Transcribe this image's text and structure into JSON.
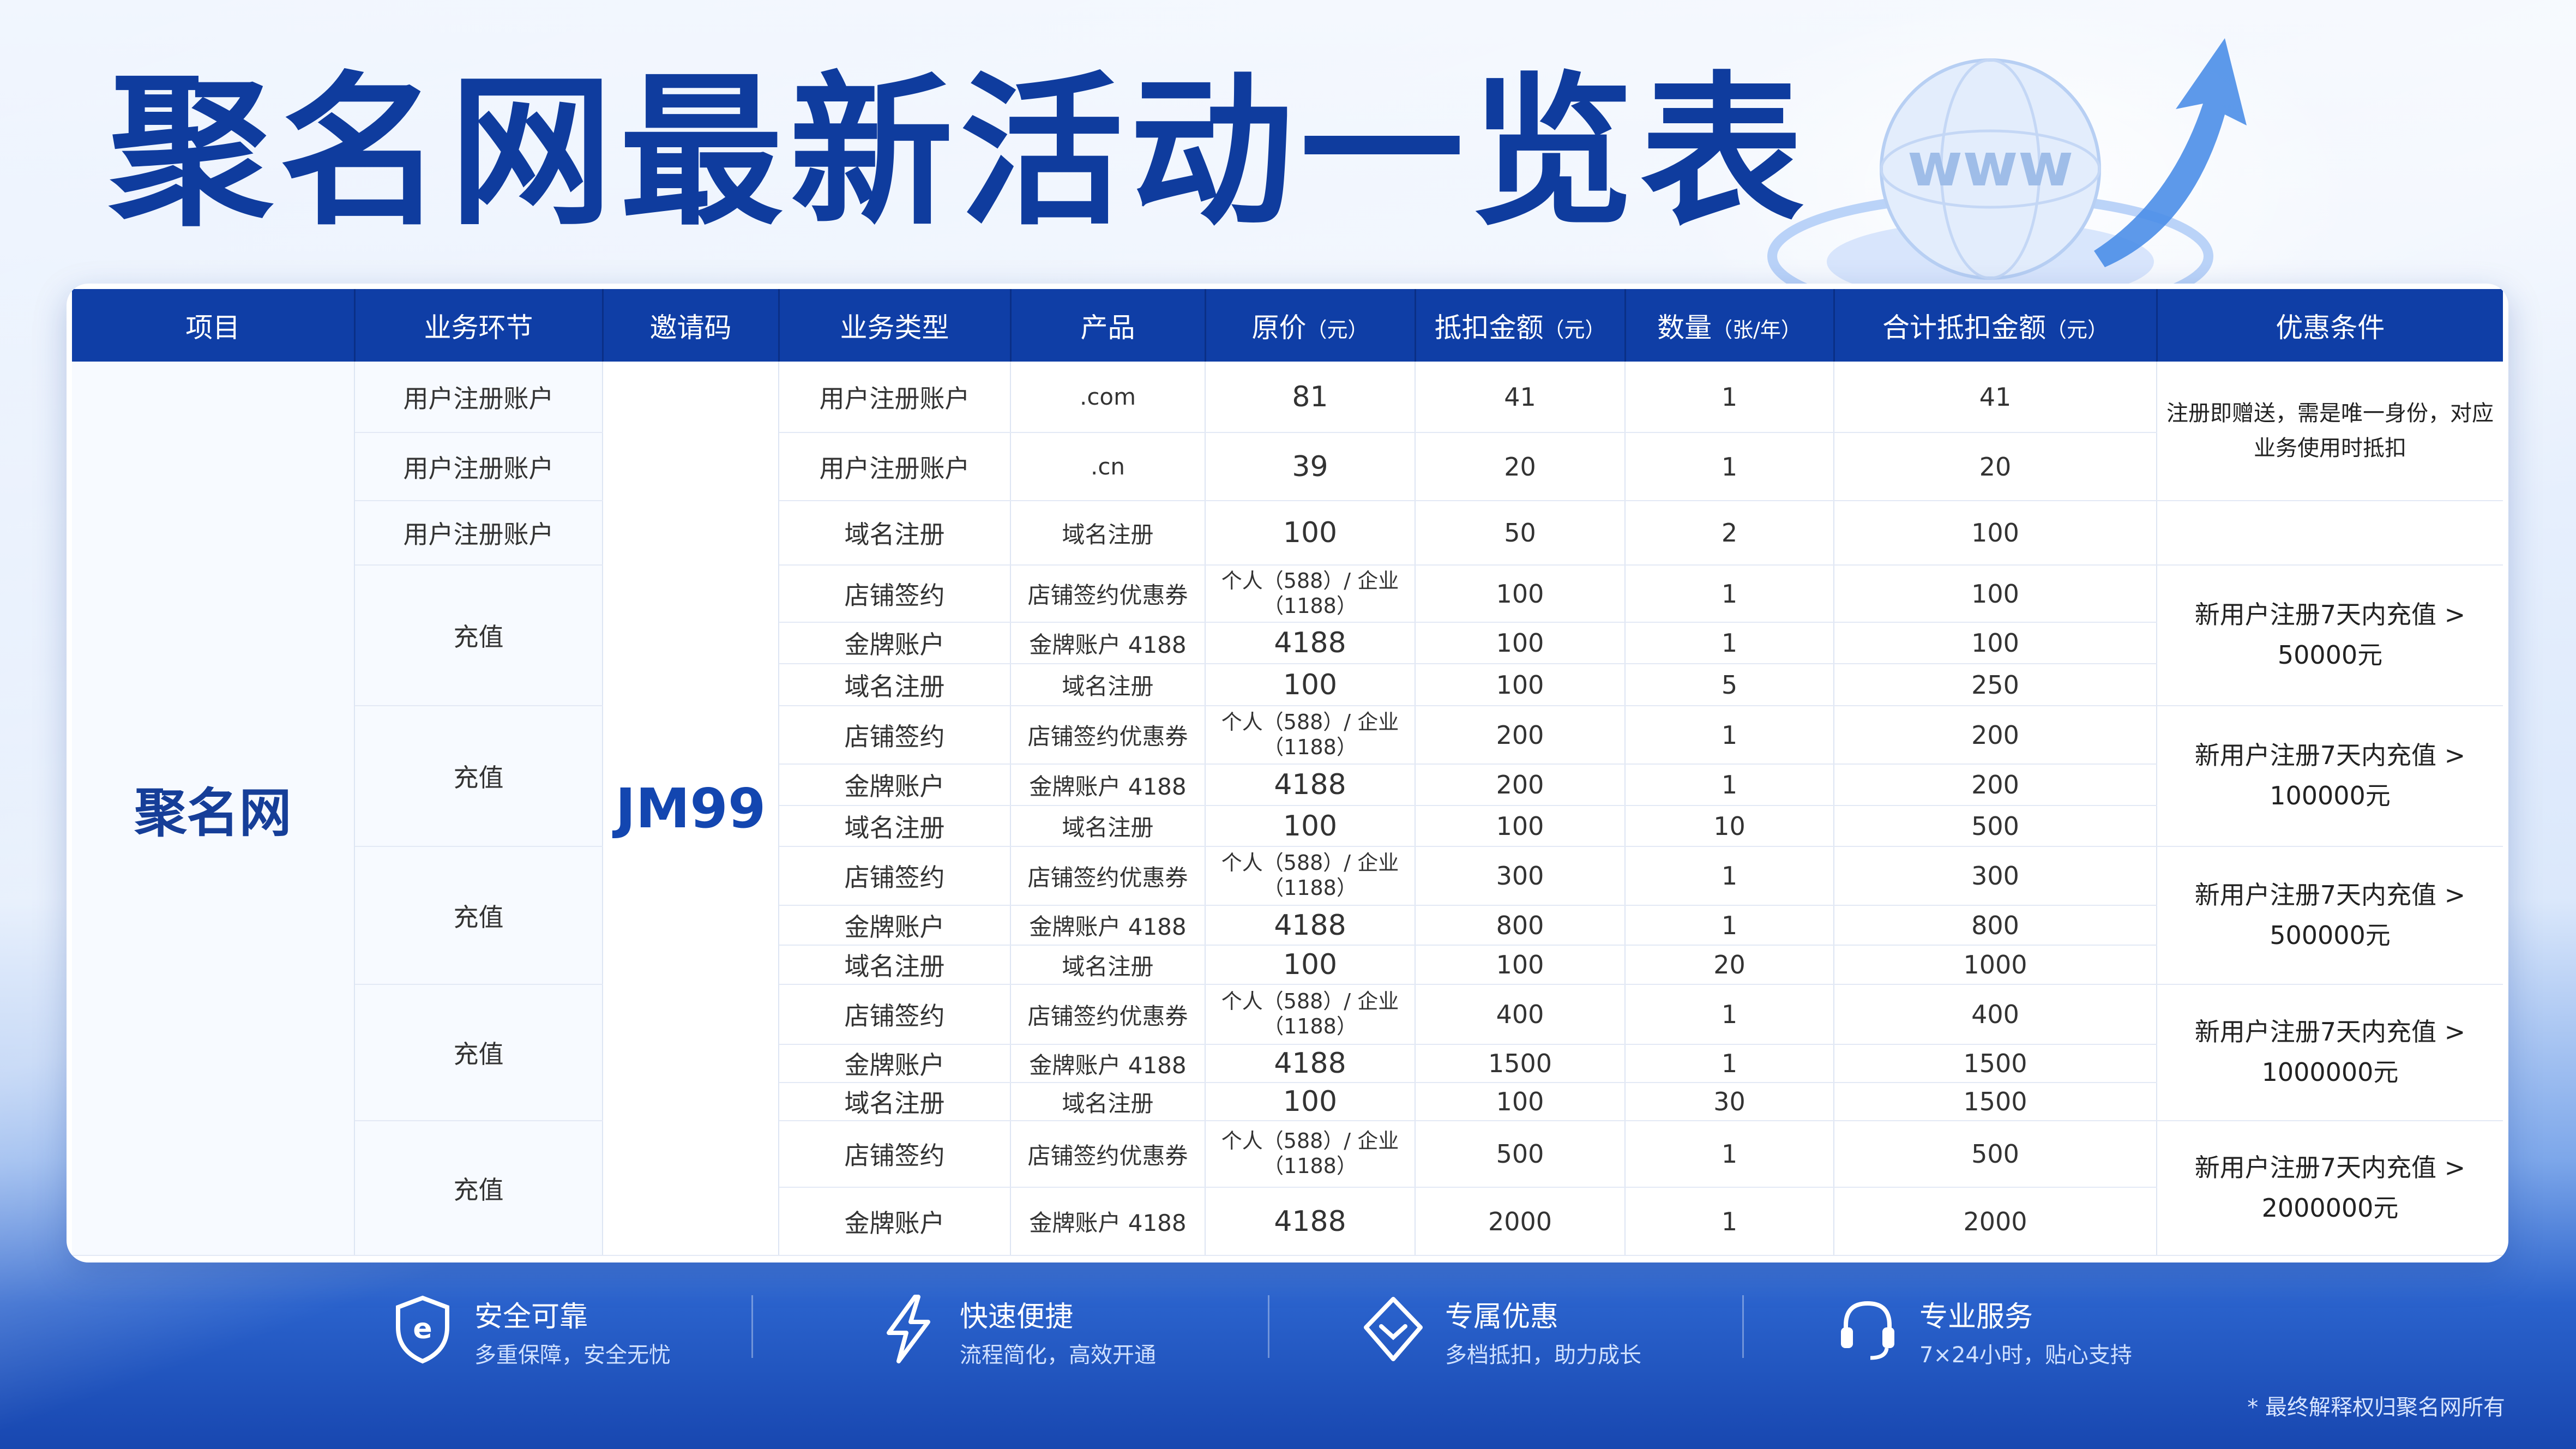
{
  "title": "聚名网最新活动一览表",
  "colors": {
    "brand": "#0f3c9e",
    "header_bg": "#0f3ea6",
    "code": "#1346b0"
  },
  "deco_text": "www",
  "table": {
    "headers": [
      {
        "label": "项目",
        "unit": ""
      },
      {
        "label": "业务环节",
        "unit": ""
      },
      {
        "label": "邀请码",
        "unit": ""
      },
      {
        "label": "业务类型",
        "unit": ""
      },
      {
        "label": "产品",
        "unit": ""
      },
      {
        "label": "原价",
        "unit": "（元）"
      },
      {
        "label": "抵扣金额",
        "unit": "（元）"
      },
      {
        "label": "数量",
        "unit": "（张/年）"
      },
      {
        "label": "合计抵扣金额",
        "unit": "（元）"
      },
      {
        "label": "优惠条件",
        "unit": ""
      }
    ],
    "project": "聚名网",
    "invite_code": "JM99",
    "top_rows": [
      {
        "stage": "用户注册账户",
        "type": "用户注册账户",
        "product": ".com",
        "price": "81",
        "discount": "41",
        "qty": "1",
        "total": "41"
      },
      {
        "stage": "用户注册账户",
        "type": "用户注册账户",
        "product": ".cn",
        "price": "39",
        "discount": "20",
        "qty": "1",
        "total": "20"
      },
      {
        "stage": "用户注册账户",
        "type": "域名注册",
        "product": "域名注册",
        "price": "100",
        "discount": "50",
        "qty": "2",
        "total": "100"
      }
    ],
    "top_condition": "注册即赠送，需是唯一身份，对应业务使用时抵扣",
    "groups": [
      {
        "stage": "充值",
        "condition": "新用户注册7天内充值 > 50000元",
        "rows": [
          {
            "type": "店铺签约",
            "product": "店铺签约优惠券",
            "price": "个人（588）/ 企业（1188）",
            "discount": "100",
            "qty": "1",
            "total": "100"
          },
          {
            "type": "金牌账户",
            "product": "金牌账户 4188",
            "price": "4188",
            "discount": "100",
            "qty": "1",
            "total": "100"
          },
          {
            "type": "域名注册",
            "product": "域名注册",
            "price": "100",
            "discount": "100",
            "qty": "5",
            "total": "250"
          }
        ]
      },
      {
        "stage": "充值",
        "condition": "新用户注册7天内充值 > 100000元",
        "rows": [
          {
            "type": "店铺签约",
            "product": "店铺签约优惠券",
            "price": "个人（588）/ 企业（1188）",
            "discount": "200",
            "qty": "1",
            "total": "200"
          },
          {
            "type": "金牌账户",
            "product": "金牌账户 4188",
            "price": "4188",
            "discount": "200",
            "qty": "1",
            "total": "200"
          },
          {
            "type": "域名注册",
            "product": "域名注册",
            "price": "100",
            "discount": "100",
            "qty": "10",
            "total": "500"
          }
        ]
      },
      {
        "stage": "充值",
        "condition": "新用户注册7天内充值 > 500000元",
        "rows": [
          {
            "type": "店铺签约",
            "product": "店铺签约优惠券",
            "price": "个人（588）/ 企业（1188）",
            "discount": "300",
            "qty": "1",
            "total": "300"
          },
          {
            "type": "金牌账户",
            "product": "金牌账户 4188",
            "price": "4188",
            "discount": "800",
            "qty": "1",
            "total": "800"
          },
          {
            "type": "域名注册",
            "product": "域名注册",
            "price": "100",
            "discount": "100",
            "qty": "20",
            "total": "1000"
          }
        ]
      },
      {
        "stage": "充值",
        "condition": "新用户注册7天内充值 > 1000000元",
        "rows": [
          {
            "type": "店铺签约",
            "product": "店铺签约优惠券",
            "price": "个人（588）/ 企业（1188）",
            "discount": "400",
            "qty": "1",
            "total": "400"
          },
          {
            "type": "金牌账户",
            "product": "金牌账户 4188",
            "price": "4188",
            "discount": "1500",
            "qty": "1",
            "total": "1500"
          },
          {
            "type": "域名注册",
            "product": "域名注册",
            "price": "100",
            "discount": "100",
            "qty": "30",
            "total": "1500"
          }
        ]
      },
      {
        "stage": "充值",
        "condition": "新用户注册7天内充值 > 2000000元",
        "rows": [
          {
            "type": "店铺签约",
            "product": "店铺签约优惠券",
            "price": "个人（588）/ 企业（1188）",
            "discount": "500",
            "qty": "1",
            "total": "500"
          },
          {
            "type": "金牌账户",
            "product": "金牌账户 4188",
            "price": "4188",
            "discount": "2000",
            "qty": "1",
            "total": "2000"
          }
        ]
      }
    ]
  },
  "features": [
    {
      "icon": "shield-icon",
      "title": "安全可靠",
      "desc": "多重保障，安全无忧"
    },
    {
      "icon": "lightning-icon",
      "title": "快速便捷",
      "desc": "流程简化，高效开通"
    },
    {
      "icon": "diamond-icon",
      "title": "专属优惠",
      "desc": "多档抵扣，助力成长"
    },
    {
      "icon": "headset-icon",
      "title": "专业服务",
      "desc": "7×24小时，贴心支持"
    }
  ],
  "footnote": "* 最终解释权归聚名网所有"
}
